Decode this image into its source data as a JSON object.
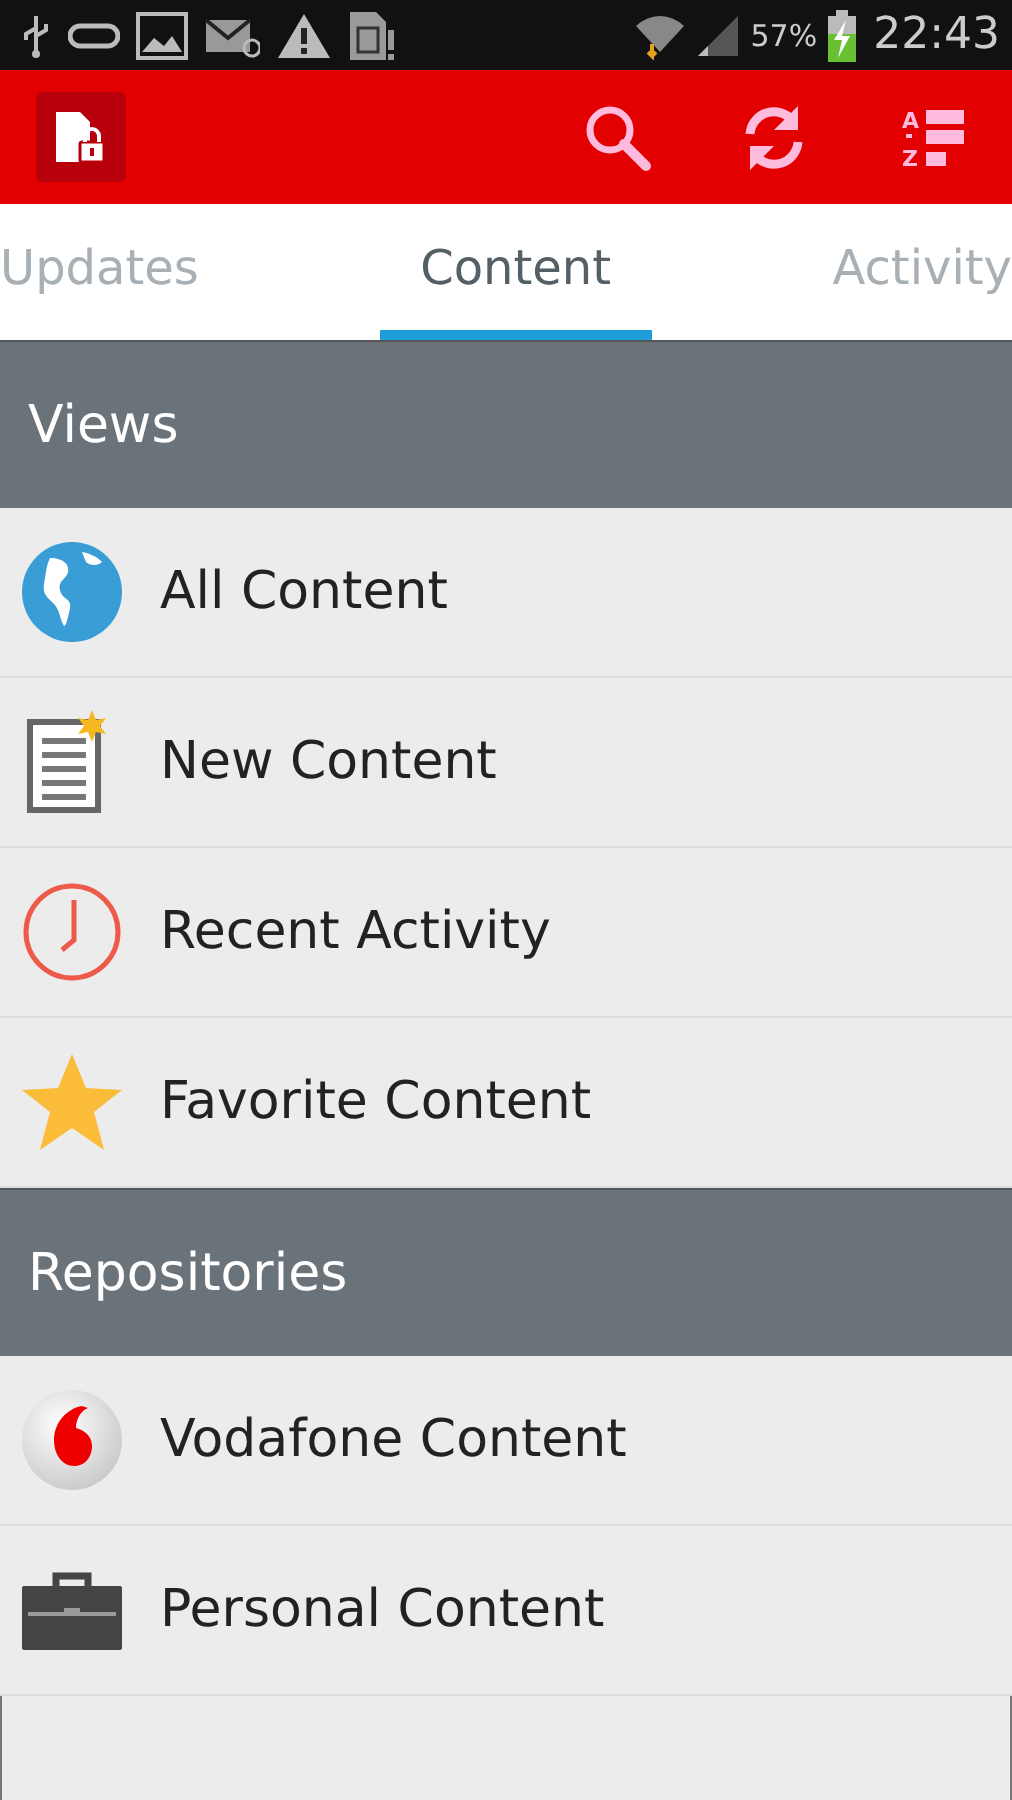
{
  "status_bar": {
    "battery": "57%",
    "time": "22:43"
  },
  "toolbar": {
    "sort_letters": [
      "A",
      "Z"
    ]
  },
  "tabs": [
    {
      "label": "Updates",
      "selected": false
    },
    {
      "label": "Content",
      "selected": true
    },
    {
      "label": "Activity",
      "selected": false
    }
  ],
  "sections": [
    {
      "title": "Views",
      "items": [
        {
          "label": "All Content",
          "kind": "globe"
        },
        {
          "label": "New Content",
          "kind": "document"
        },
        {
          "label": "Recent Activity",
          "kind": "clock"
        },
        {
          "label": "Favorite Content",
          "kind": "star"
        }
      ]
    },
    {
      "title": "Repositories",
      "items": [
        {
          "label": "Vodafone Content",
          "kind": "vodafone"
        },
        {
          "label": "Personal Content",
          "kind": "briefcase"
        }
      ]
    }
  ]
}
